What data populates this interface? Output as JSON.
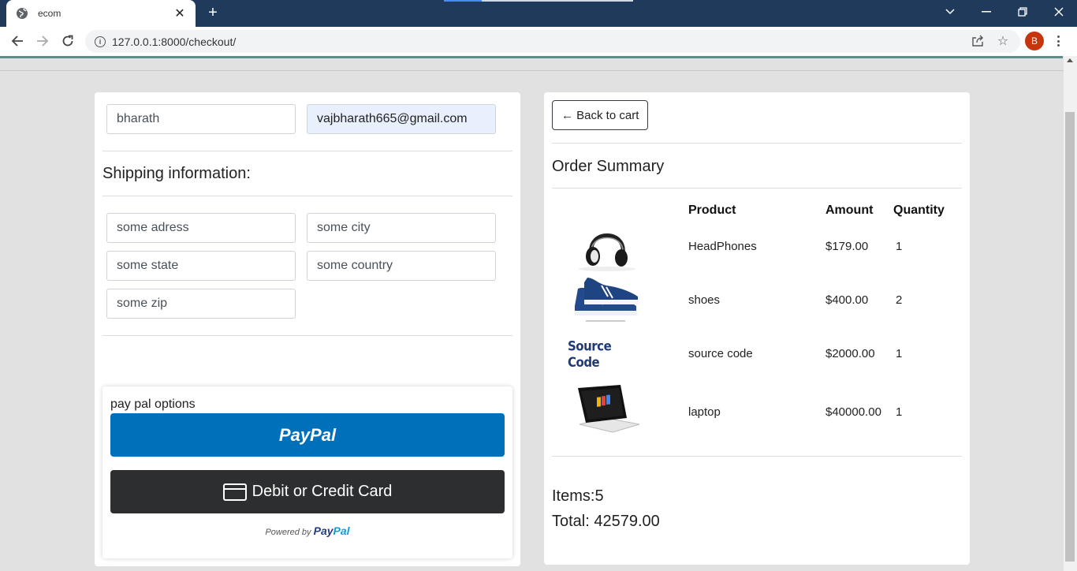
{
  "browser": {
    "tab_title": "ecom",
    "url": "127.0.0.1:8000/checkout/",
    "profile_initial": "B"
  },
  "user_info": {
    "name_value": "bharath",
    "email_value": "vajbharath665@gmail.com"
  },
  "shipping": {
    "title": "Shipping information:",
    "address": "some adress",
    "city": "some city",
    "state": "some state",
    "country": "some country",
    "zip": "some zip"
  },
  "payment": {
    "label": "pay pal options",
    "paypal_button": "PayPal",
    "card_button": "Debit or Credit Card",
    "powered_prefix": "Powered by",
    "powered_brand_1": "Pay",
    "powered_brand_2": "Pal"
  },
  "summary": {
    "back_button": "← Back to cart",
    "title": "Order Summary",
    "columns": [
      "Product",
      "Amount",
      "Quantity"
    ],
    "items": [
      {
        "name": "HeadPhones",
        "amount": "$179.00",
        "qty": "1",
        "image": "headphones-image"
      },
      {
        "name": "shoes",
        "amount": "$400.00",
        "qty": "2",
        "image": "shoes-image"
      },
      {
        "name": "source code",
        "amount": "$2000.00",
        "qty": "1",
        "image": "source-code-image",
        "image_text": "Source Code"
      },
      {
        "name": "laptop",
        "amount": "$40000.00",
        "qty": "1",
        "image": "laptop-image"
      }
    ],
    "items_line": "Items:5",
    "total_line": "Total: 42579.00"
  },
  "colors": {
    "titlebar": "#203a5c",
    "paypal_blue": "#0070ba",
    "card_dark": "#2c2e2f",
    "autofill": "#e8f0fe"
  }
}
